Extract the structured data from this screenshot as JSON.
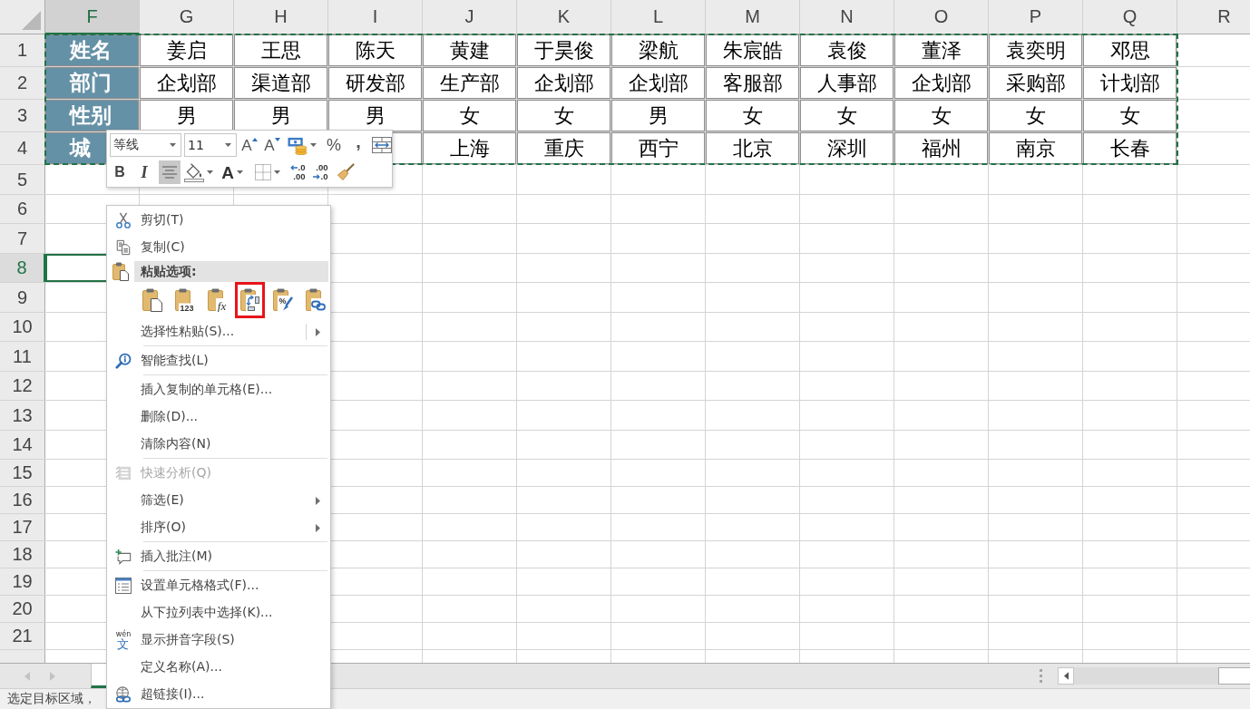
{
  "sheet": {
    "columns": [
      {
        "label": "F",
        "selected": true
      },
      {
        "label": "G",
        "selected": false
      },
      {
        "label": "H",
        "selected": false
      },
      {
        "label": "I",
        "selected": false
      },
      {
        "label": "J",
        "selected": false
      },
      {
        "label": "K",
        "selected": false
      },
      {
        "label": "L",
        "selected": false
      },
      {
        "label": "M",
        "selected": false
      },
      {
        "label": "N",
        "selected": false
      },
      {
        "label": "O",
        "selected": false
      },
      {
        "label": "P",
        "selected": false
      },
      {
        "label": "Q",
        "selected": false
      },
      {
        "label": "R",
        "selected": false
      }
    ],
    "row_headers": [
      {
        "label": "1",
        "selected": false
      },
      {
        "label": "2",
        "selected": false
      },
      {
        "label": "3",
        "selected": false
      },
      {
        "label": "4",
        "selected": false
      },
      {
        "label": "5",
        "selected": false
      },
      {
        "label": "6",
        "selected": false
      },
      {
        "label": "7",
        "selected": false
      },
      {
        "label": "8",
        "selected": true
      },
      {
        "label": "9",
        "selected": false
      },
      {
        "label": "10",
        "selected": false
      },
      {
        "label": "11",
        "selected": false
      },
      {
        "label": "12",
        "selected": false
      },
      {
        "label": "13",
        "selected": false
      },
      {
        "label": "14",
        "selected": false
      },
      {
        "label": "15",
        "selected": false
      },
      {
        "label": "16",
        "selected": false
      },
      {
        "label": "17",
        "selected": false
      },
      {
        "label": "18",
        "selected": false
      },
      {
        "label": "19",
        "selected": false
      },
      {
        "label": "20",
        "selected": false
      },
      {
        "label": "21",
        "selected": false
      }
    ],
    "rows": [
      [
        {
          "kind": "label",
          "text": "姓名"
        },
        {
          "kind": "data",
          "text": "姜启"
        },
        {
          "kind": "data",
          "text": "王思"
        },
        {
          "kind": "data",
          "text": "陈天"
        },
        {
          "kind": "data",
          "text": "黄建"
        },
        {
          "kind": "data",
          "text": "于昊俊"
        },
        {
          "kind": "data",
          "text": "梁航"
        },
        {
          "kind": "data",
          "text": "朱宸皓"
        },
        {
          "kind": "data",
          "text": "袁俊"
        },
        {
          "kind": "data",
          "text": "董泽"
        },
        {
          "kind": "data",
          "text": "袁奕明"
        },
        {
          "kind": "data",
          "text": "邓思"
        }
      ],
      [
        {
          "kind": "label",
          "text": "部门"
        },
        {
          "kind": "data",
          "text": "企划部"
        },
        {
          "kind": "data",
          "text": "渠道部"
        },
        {
          "kind": "data",
          "text": "研发部"
        },
        {
          "kind": "data",
          "text": "生产部"
        },
        {
          "kind": "data",
          "text": "企划部"
        },
        {
          "kind": "data",
          "text": "企划部"
        },
        {
          "kind": "data",
          "text": "客服部"
        },
        {
          "kind": "data",
          "text": "人事部"
        },
        {
          "kind": "data",
          "text": "企划部"
        },
        {
          "kind": "data",
          "text": "采购部"
        },
        {
          "kind": "data",
          "text": "计划部"
        }
      ],
      [
        {
          "kind": "label",
          "text": "性别"
        },
        {
          "kind": "data",
          "text": "男"
        },
        {
          "kind": "data",
          "text": "男"
        },
        {
          "kind": "data",
          "text": "男"
        },
        {
          "kind": "data",
          "text": "女"
        },
        {
          "kind": "data",
          "text": "女"
        },
        {
          "kind": "data",
          "text": "男"
        },
        {
          "kind": "data",
          "text": "女"
        },
        {
          "kind": "data",
          "text": "女"
        },
        {
          "kind": "data",
          "text": "女"
        },
        {
          "kind": "data",
          "text": "女"
        },
        {
          "kind": "data",
          "text": "女"
        }
      ],
      [
        {
          "kind": "label",
          "text": "城"
        },
        {},
        {},
        {
          "kind": "data"
        },
        {
          "kind": "data",
          "text": "上海"
        },
        {
          "kind": "data",
          "text": "重庆"
        },
        {
          "kind": "data",
          "text": "西宁"
        },
        {
          "kind": "data",
          "text": "北京"
        },
        {
          "kind": "data",
          "text": "深圳"
        },
        {
          "kind": "data",
          "text": "福州"
        },
        {
          "kind": "data",
          "text": "南京"
        },
        {
          "kind": "data",
          "text": "长春"
        }
      ]
    ],
    "copy_marquee": true
  },
  "mini_toolbar": {
    "rows": [
      [
        {
          "kind": "font-name",
          "value": "等线"
        },
        {
          "kind": "font-size",
          "value": "11"
        },
        {
          "kind": "grow-font",
          "label": "A",
          "on": false,
          "dropdown": false
        },
        {
          "kind": "shrink-font",
          "label": "A",
          "on": false,
          "dropdown": false
        },
        {
          "kind": "accounting",
          "on": false,
          "dropdown": true
        },
        {
          "kind": "percent",
          "label": "%",
          "on": false,
          "dropdown": false
        },
        {
          "kind": "comma",
          "label": ",",
          "on": false,
          "dropdown": false
        },
        {
          "kind": "wrap-merge",
          "on": false,
          "dropdown": false
        }
      ],
      [
        {
          "kind": "bold",
          "label": "B",
          "on": false,
          "dropdown": false
        },
        {
          "kind": "italic",
          "label": "I",
          "on": false,
          "dropdown": false
        },
        {
          "kind": "center",
          "on": true,
          "dropdown": false
        },
        {
          "kind": "fill-color",
          "on": false,
          "dropdown": true
        },
        {
          "kind": "font-color",
          "label": "A",
          "on": false,
          "dropdown": true
        },
        {
          "kind": "borders",
          "on": false,
          "dropdown": true
        },
        {
          "kind": "increase-decimal",
          "lines": [
            ".0",
            ".00"
          ],
          "on": false,
          "dropdown": false
        },
        {
          "kind": "decrease-decimal",
          "lines": [
            ".00",
            ".0"
          ],
          "on": false,
          "dropdown": false
        },
        {
          "kind": "format-painter",
          "on": false,
          "dropdown": false
        }
      ]
    ]
  },
  "context_menu": {
    "sections": [
      [
        {
          "kind": "cut",
          "label": "剪切(T)",
          "disabled": false,
          "submenu": false
        },
        {
          "kind": "copy",
          "label": "复制(C)",
          "disabled": false,
          "submenu": false
        },
        {
          "kind": "paste-header",
          "label": "粘贴选项:"
        },
        {
          "kind": "paste-options",
          "options": [
            {
              "kind": "paste",
              "highlighted": false
            },
            {
              "kind": "values",
              "glyph": "123",
              "highlighted": false
            },
            {
              "kind": "formulas",
              "glyph": "fx",
              "highlighted": false
            },
            {
              "kind": "transpose",
              "highlighted": true
            },
            {
              "kind": "formatting",
              "glyph": "%",
              "highlighted": false
            },
            {
              "kind": "link",
              "highlighted": false
            }
          ]
        },
        {
          "kind": "split-command",
          "label": "选择性粘贴(S)...",
          "disabled": false,
          "submenu": true
        }
      ],
      [
        {
          "kind": "smart-lookup",
          "label": "智能查找(L)",
          "disabled": false,
          "submenu": false
        }
      ],
      [
        {
          "kind": "command",
          "label": "插入复制的单元格(E)...",
          "disabled": false,
          "submenu": false
        },
        {
          "kind": "command",
          "label": "删除(D)...",
          "disabled": false,
          "submenu": false
        },
        {
          "kind": "command",
          "label": "清除内容(N)",
          "disabled": false,
          "submenu": false
        }
      ],
      [
        {
          "kind": "quick-analysis",
          "label": "快速分析(Q)",
          "disabled": true,
          "submenu": false
        },
        {
          "kind": "command",
          "label": "筛选(E)",
          "disabled": false,
          "submenu": true
        },
        {
          "kind": "command",
          "label": "排序(O)",
          "disabled": false,
          "submenu": true
        }
      ],
      [
        {
          "kind": "comment",
          "label": "插入批注(M)",
          "disabled": false,
          "submenu": false
        }
      ],
      [
        {
          "kind": "format-cells",
          "label": "设置单元格格式(F)...",
          "disabled": false,
          "submenu": false
        },
        {
          "kind": "command",
          "label": "从下拉列表中选择(K)...",
          "disabled": false,
          "submenu": false
        },
        {
          "kind": "phonetic",
          "label": "显示拼音字段(S)",
          "glyphs": [
            "wén",
            "文"
          ],
          "disabled": false,
          "submenu": false
        },
        {
          "kind": "command",
          "label": "定义名称(A)...",
          "disabled": false,
          "submenu": false
        },
        {
          "kind": "hyperlink",
          "label": "超链接(I)...",
          "disabled": false,
          "submenu": false
        }
      ]
    ]
  },
  "sheet_tabs": [
    {
      "selected": true
    }
  ],
  "status_bar": {
    "text": "选定目标区域，"
  }
}
